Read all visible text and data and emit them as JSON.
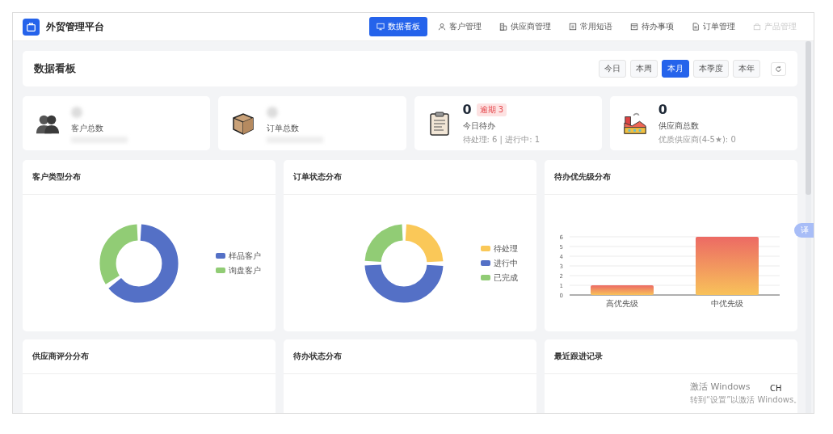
{
  "app": {
    "title": "外贸管理平台"
  },
  "nav": [
    {
      "label": "数据看板",
      "selected": true,
      "disabled": false
    },
    {
      "label": "客户管理",
      "selected": false,
      "disabled": false
    },
    {
      "label": "供应商管理",
      "selected": false,
      "disabled": false
    },
    {
      "label": "常用短语",
      "selected": false,
      "disabled": false
    },
    {
      "label": "待办事项",
      "selected": false,
      "disabled": false
    },
    {
      "label": "订单管理",
      "selected": false,
      "disabled": false
    },
    {
      "label": "产品管理",
      "selected": false,
      "disabled": true
    }
  ],
  "dashboard": {
    "title": "数据看板",
    "periods": [
      {
        "label": "今日",
        "selected": false
      },
      {
        "label": "本周",
        "selected": false
      },
      {
        "label": "本月",
        "selected": true
      },
      {
        "label": "本季度",
        "selected": false
      },
      {
        "label": "本年",
        "selected": false
      }
    ]
  },
  "stats": [
    {
      "kind": "people",
      "value_hidden": true,
      "label": "客户总数"
    },
    {
      "kind": "parcel",
      "value_hidden": true,
      "label": "订单总数"
    },
    {
      "kind": "clipboard",
      "value_hidden": false,
      "value": "0",
      "badge": "逾期 3",
      "label": "今日待办",
      "detail": "待处理: 6 | 进行中: 1"
    },
    {
      "kind": "factory",
      "value_hidden": false,
      "value": "0",
      "label": "供应商总数",
      "detail": "优质供应商(4-5★): 0"
    }
  ],
  "charts": [
    {
      "kind": "donut",
      "title": "客户类型分布",
      "legend": [
        {
          "label": "样品客户",
          "color": "#5470c6"
        },
        {
          "label": "询盘客户",
          "color": "#91cc75"
        }
      ]
    },
    {
      "kind": "donut",
      "title": "订单状态分布",
      "legend": [
        {
          "label": "待处理",
          "color": "#fac858"
        },
        {
          "label": "进行中",
          "color": "#5470c6"
        },
        {
          "label": "已完成",
          "color": "#91cc75"
        }
      ]
    },
    {
      "kind": "bar",
      "title": "待办优先级分布",
      "chart_data": {
        "type": "bar",
        "categories": [
          "高优先级",
          "中优先级"
        ],
        "values": [
          1,
          6
        ],
        "ylim": [
          0,
          6
        ],
        "grid": true,
        "yticks": [
          0,
          1,
          2,
          3,
          4,
          5,
          6
        ]
      }
    },
    {
      "kind": "empty-donut",
      "title": "供应商评分分布"
    },
    {
      "kind": "empty",
      "title": "待办状态分布"
    },
    {
      "kind": "empty",
      "title": "最近跟进记录"
    }
  ],
  "translate_button": {
    "label": "译"
  },
  "os_notice": {
    "title": "激活 Windows",
    "text": "转到“设置”以激活 Windows。",
    "ime": "CH"
  }
}
